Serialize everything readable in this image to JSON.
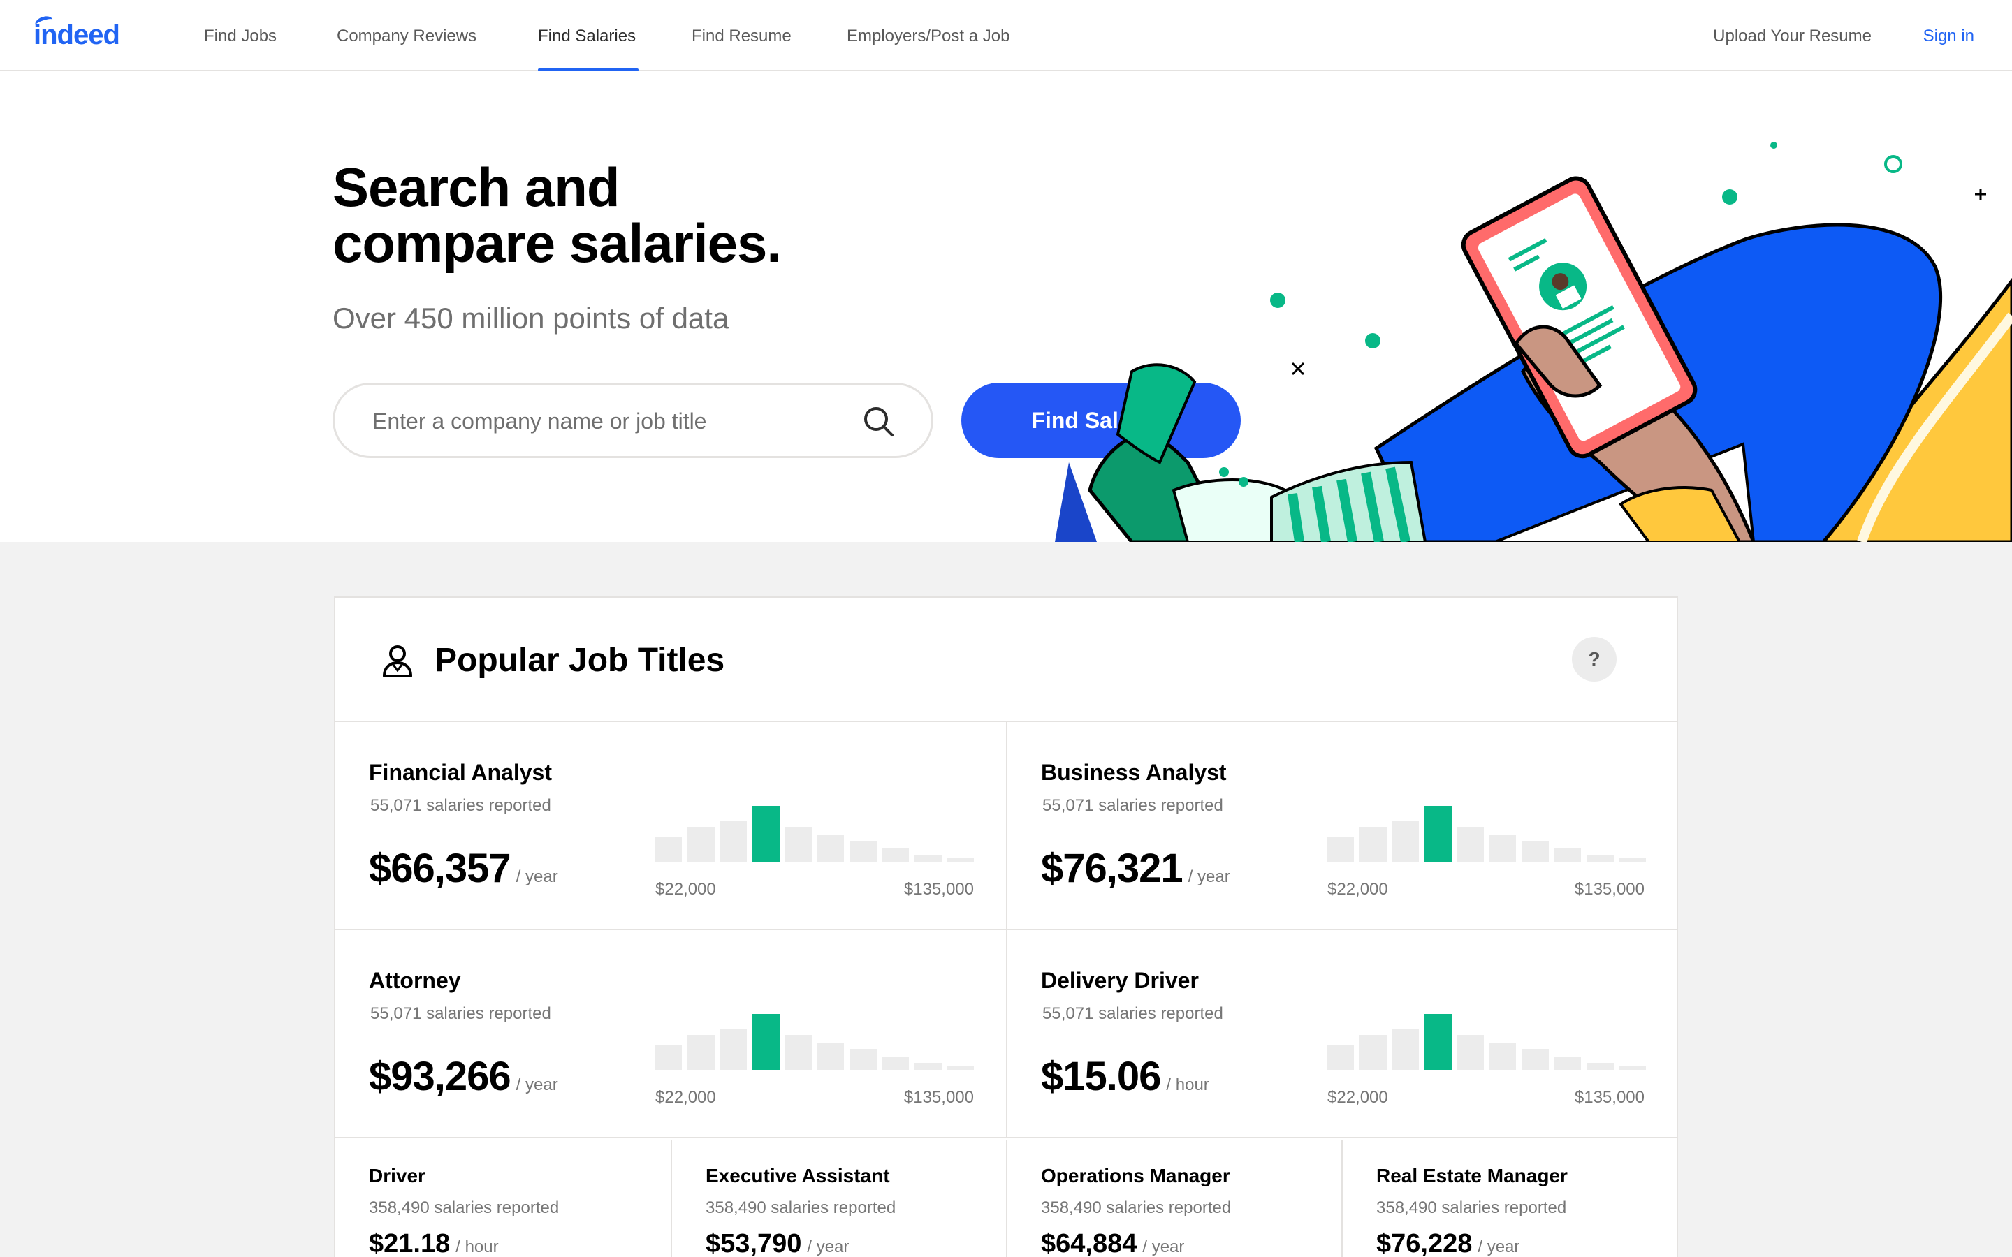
{
  "nav": {
    "logo": "indeed",
    "links": [
      "Find Jobs",
      "Company Reviews",
      "Find Salaries",
      "Find Resume",
      "Employers/Post a Job"
    ],
    "upload": "Upload Your Resume",
    "signin": "Sign in"
  },
  "hero": {
    "title_line1": "Search and",
    "title_line2": "compare salaries.",
    "subtitle": "Over 450 million points of data",
    "search_placeholder": "Enter a company name or job title",
    "button": "Find Salaries"
  },
  "popular": {
    "title": "Popular Job Titles",
    "help": "?",
    "featured": [
      {
        "title": "Financial Analyst",
        "count": "55,071 salaries reported",
        "salary": "$66,357",
        "period": "/ year",
        "min": "$22,000",
        "max": "$135,000",
        "bars": [
          0.45,
          0.62,
          0.74,
          1.0,
          0.62,
          0.48,
          0.38,
          0.24,
          0.13,
          0.07
        ],
        "highlight_index": 3
      },
      {
        "title": "Business Analyst",
        "count": "55,071 salaries reported",
        "salary": "$76,321",
        "period": "/ year",
        "min": "$22,000",
        "max": "$135,000",
        "bars": [
          0.45,
          0.62,
          0.74,
          1.0,
          0.62,
          0.48,
          0.38,
          0.24,
          0.13,
          0.07
        ],
        "highlight_index": 3
      },
      {
        "title": "Attorney",
        "count": "55,071 salaries reported",
        "salary": "$93,266",
        "period": "/ year",
        "min": "$22,000",
        "max": "$135,000",
        "bars": [
          0.45,
          0.62,
          0.74,
          1.0,
          0.62,
          0.48,
          0.38,
          0.24,
          0.13,
          0.07
        ],
        "highlight_index": 3
      },
      {
        "title": "Delivery Driver",
        "count": "55,071 salaries reported",
        "salary": "$15.06",
        "period": "/ hour",
        "min": "$22,000",
        "max": "$135,000",
        "bars": [
          0.45,
          0.62,
          0.74,
          1.0,
          0.62,
          0.48,
          0.38,
          0.24,
          0.13,
          0.07
        ],
        "highlight_index": 3
      }
    ],
    "others": [
      {
        "title": "Driver",
        "count": "358,490 salaries reported",
        "salary": "$21.18",
        "period": "/ hour"
      },
      {
        "title": "Executive Assistant",
        "count": "358,490 salaries reported",
        "salary": "$53,790",
        "period": "/ year"
      },
      {
        "title": "Operations Manager",
        "count": "358,490 salaries reported",
        "salary": "$64,884",
        "period": "/ year"
      },
      {
        "title": "Real Estate Manager",
        "count": "358,490 salaries reported",
        "salary": "$76,228",
        "period": "/ year"
      }
    ]
  },
  "colors": {
    "brand_blue": "#2164f3",
    "button_blue": "#2557f5",
    "highlight_green": "#08b887"
  }
}
